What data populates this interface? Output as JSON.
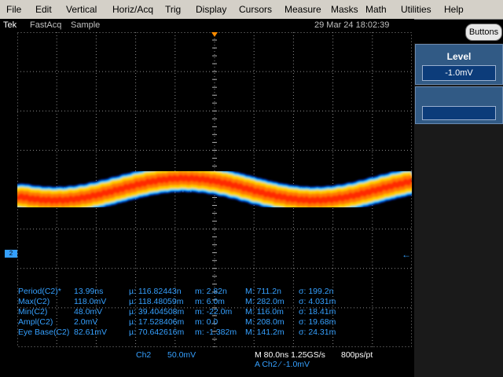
{
  "menu": [
    "File",
    "Edit",
    "Vertical",
    "Horiz/Acq",
    "Trig",
    "Display",
    "Cursors",
    "Measure",
    "Masks",
    "Math",
    "Utilities",
    "Help"
  ],
  "status": {
    "brand": "Tek",
    "mode": "FastAcq",
    "acq": "Sample",
    "datetime": "29 Mar 24 18:02:39"
  },
  "buttons_label": "Buttons",
  "level_panel": {
    "title": "Level",
    "value": "-1.0mV"
  },
  "measurements": [
    {
      "name": "Period(C2)*",
      "value": "13.99ns",
      "mean": "µ: 116.82443n",
      "min": "m: 2.82n",
      "max": "M: 711.2n",
      "sd": "σ: 199.2n"
    },
    {
      "name": "Max(C2)",
      "value": "118.0mV",
      "mean": "µ: 118.48059m",
      "min": "m: 6.0m",
      "max": "M: 282.0m",
      "sd": "σ: 4.031m"
    },
    {
      "name": "Min(C2)",
      "value": "48.0mV",
      "mean": "µ: 39.404508m",
      "min": "m: -22.0m",
      "max": "M: 116.0m",
      "sd": "σ: 18.41m"
    },
    {
      "name": "Ampl(C2)",
      "value": "2.0mV",
      "mean": "µ: 17.528406m",
      "min": "m: 0.0",
      "max": "M: 208.0m",
      "sd": "σ: 19.68m"
    },
    {
      "name": "Eye Base(C2)",
      "value": "82.61mV",
      "mean": "µ: 70.642616m",
      "min": "m: -1.382m",
      "max": "M: 141.2m",
      "sd": "σ: 24.31m"
    }
  ],
  "bottom": {
    "channel": "Ch2",
    "scale": "50.0mV",
    "timebase": "M 80.0ns 1.25GS/s",
    "ptsper": "800ps/pt",
    "trigger": "A  Ch2  ⁄  -1.0mV"
  },
  "colors": {
    "menubar": "#d4d0c8",
    "measure_text": "#35a0ff",
    "grid": "#9a9a9a",
    "trace_core": "#ff2a00",
    "trace_mid": "#ffd000",
    "trace_edge": "#0040ff",
    "panel": "#315a85"
  }
}
